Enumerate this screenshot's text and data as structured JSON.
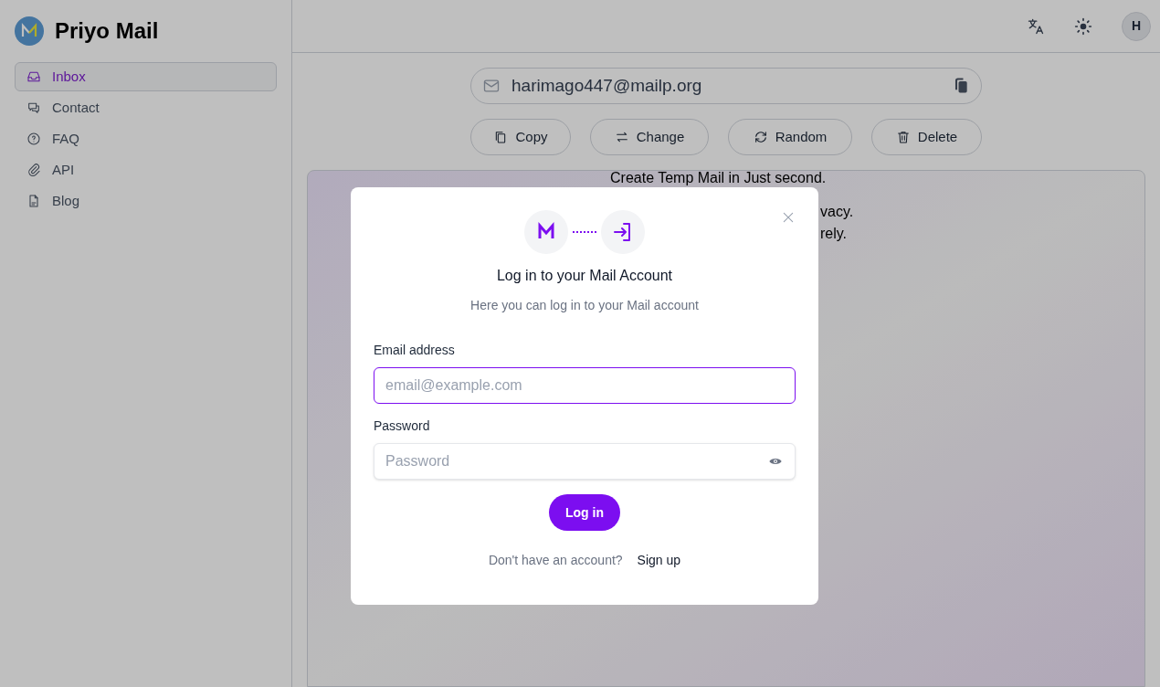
{
  "app": {
    "name": "Priyo Mail"
  },
  "sidebar": {
    "items": [
      {
        "label": "Inbox",
        "kind": "inbox",
        "selected": true
      },
      {
        "label": "Contact",
        "kind": "chat",
        "selected": false
      },
      {
        "label": "FAQ",
        "kind": "help",
        "selected": false
      },
      {
        "label": "API",
        "kind": "clip",
        "selected": false
      },
      {
        "label": "Blog",
        "kind": "doc",
        "selected": false
      }
    ]
  },
  "header": {
    "avatar": "H"
  },
  "address": {
    "value": "harimago447@mailp.org"
  },
  "actions": [
    {
      "label": "Copy",
      "kind": "copy"
    },
    {
      "label": "Change",
      "kind": "swap"
    },
    {
      "label": "Random",
      "kind": "refresh"
    },
    {
      "label": "Delete",
      "kind": "trash"
    }
  ],
  "content": {
    "lines": [
      "Create Temp Mail in Just second.",
      "vacy.",
      "rely."
    ]
  },
  "modal": {
    "title": "Log in to your Mail Account",
    "subtitle": "Here you can log in to your Mail account",
    "fields": [
      {
        "label": "Email address",
        "placeholder": "email@example.com",
        "focused": true,
        "kind": "email"
      },
      {
        "label": "Password",
        "placeholder": "Password",
        "focused": false,
        "kind": "password"
      }
    ],
    "submit": "Log in",
    "footer_text": "Don't have an account?",
    "footer_link": "Sign up"
  }
}
